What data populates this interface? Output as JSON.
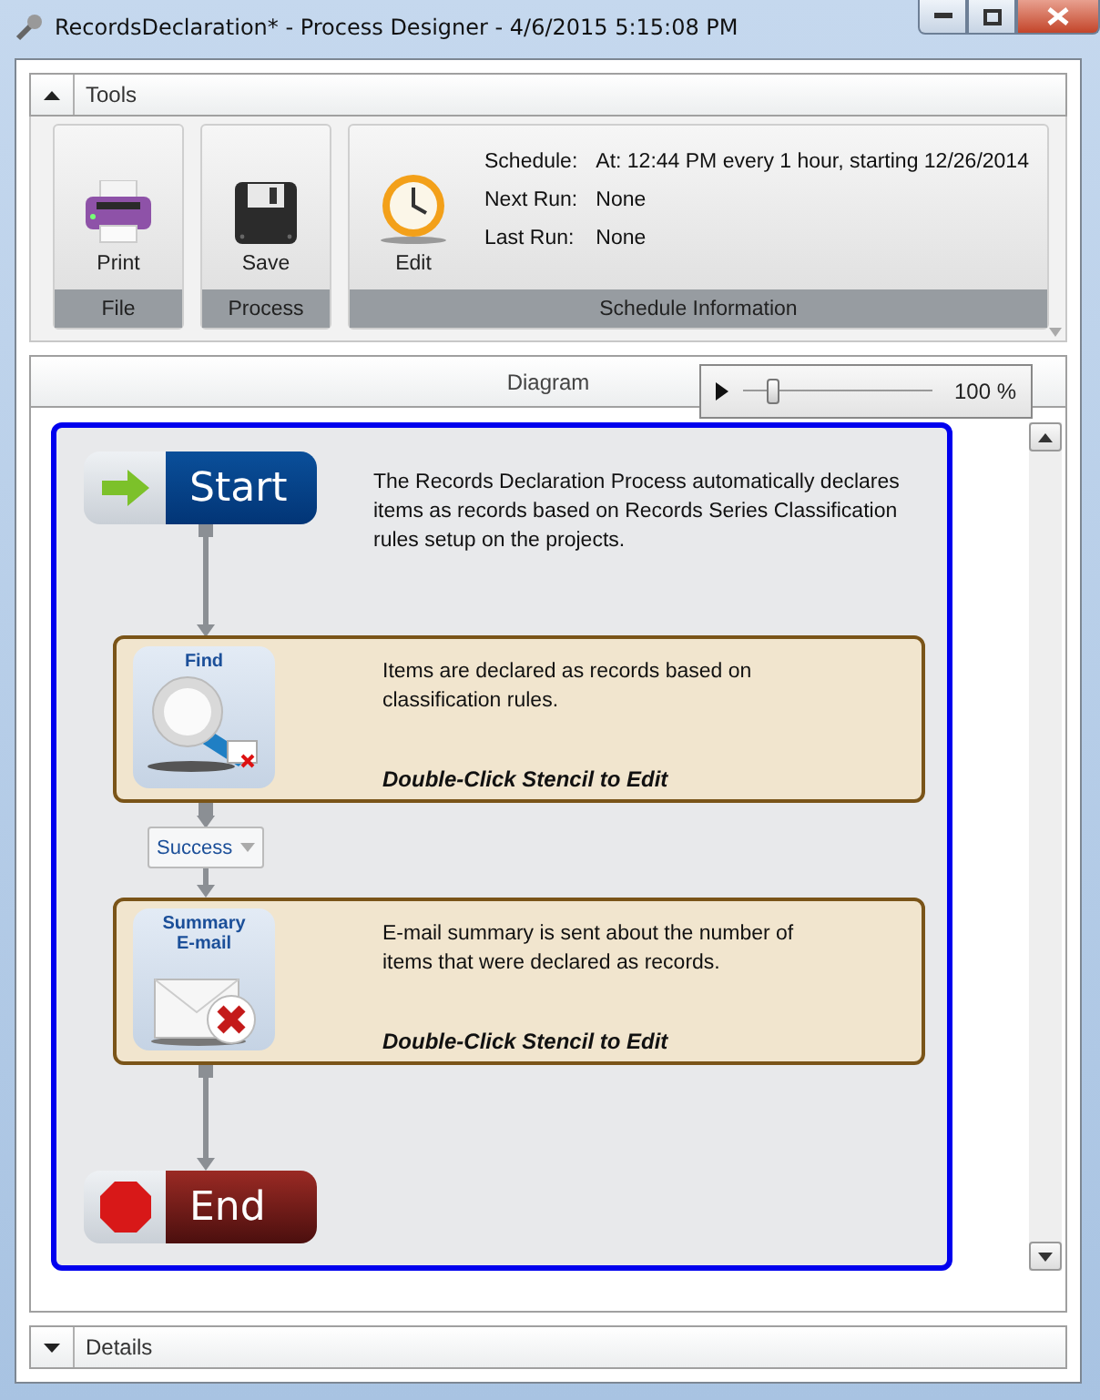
{
  "window": {
    "title": "RecordsDeclaration* - Process Designer - 4/6/2015 5:15:08 PM"
  },
  "tools": {
    "title": "Tools",
    "expanded": true,
    "groups": [
      {
        "label": "File",
        "buttons": [
          {
            "label": "Print",
            "kind": "print"
          }
        ]
      },
      {
        "label": "Process",
        "buttons": [
          {
            "label": "Save",
            "kind": "save"
          }
        ]
      },
      {
        "label": "Schedule Information",
        "buttons": [
          {
            "label": "Edit",
            "kind": "clock"
          }
        ],
        "fields": [
          {
            "label": "Schedule:",
            "value": "At: 12:44 PM every 1 hour, starting 12/26/2014"
          },
          {
            "label": "Next Run:",
            "value": "None"
          },
          {
            "label": "Last Run:",
            "value": "None"
          }
        ]
      }
    ]
  },
  "diagram": {
    "title": "Diagram",
    "zoom": {
      "level": 0.15,
      "reading": "100 %"
    },
    "start": {
      "label": "Start",
      "description": "The Records Declaration Process automatically declares items as records based on Records Series Classification rules setup on the projects."
    },
    "steps": [
      {
        "kind": "find",
        "title": "Find",
        "description": "Items are declared as records based on classification rules.",
        "hint": "Double-Click Stencil to Edit",
        "outcome": "Success"
      },
      {
        "kind": "email",
        "title": "Summary E-mail",
        "description": "E-mail summary is sent about the number of items that were declared as records.",
        "hint": "Double-Click Stencil to Edit"
      }
    ],
    "end": {
      "label": "End"
    }
  },
  "details": {
    "title": "Details",
    "expanded": false
  }
}
